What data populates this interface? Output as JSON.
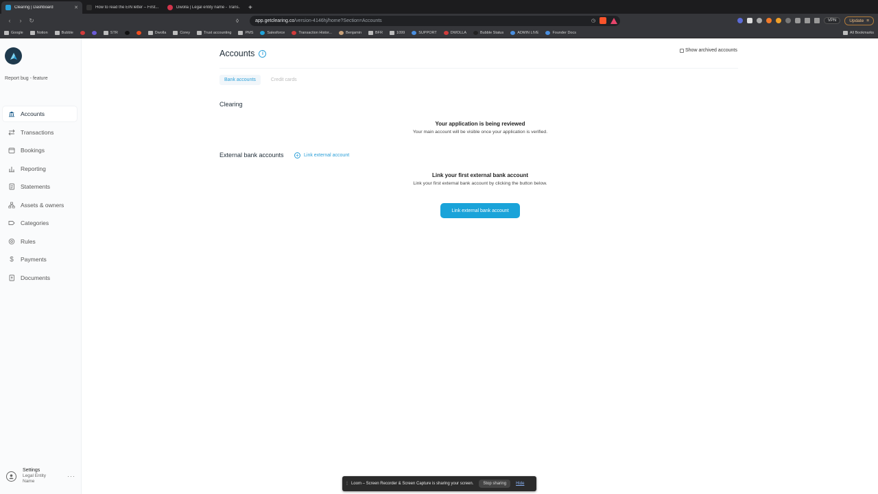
{
  "browser": {
    "tabs": [
      {
        "title": "Clearing | Dashboard",
        "favicon_color": "#2a9fd8"
      },
      {
        "title": "How to read the EIN letter – First...",
        "favicon_color": "#333333"
      },
      {
        "title": "Dwolla | Legal entity name - Trans...",
        "favicon_color": "#d1344b"
      }
    ],
    "new_tab_label": "+",
    "url_host": "app.getclearing.co",
    "url_path": "/version-4146hj/home?Section=Accounts",
    "vpn_label": "VPN",
    "update_label": "Update",
    "bookmarks": [
      {
        "label": "Google",
        "kind": "folder"
      },
      {
        "label": "Notion",
        "kind": "folder"
      },
      {
        "label": "Bubble",
        "kind": "folder"
      },
      {
        "label": "",
        "kind": "icon-red"
      },
      {
        "label": "",
        "kind": "icon-purple"
      },
      {
        "label": "STR",
        "kind": "folder"
      },
      {
        "label": "",
        "kind": "icon-c"
      },
      {
        "label": "",
        "kind": "icon-figma"
      },
      {
        "label": "Dwolla",
        "kind": "folder"
      },
      {
        "label": "Corey",
        "kind": "folder"
      },
      {
        "label": "Trust accounting",
        "kind": "folder"
      },
      {
        "label": "PMS",
        "kind": "folder"
      },
      {
        "label": "Salesforce",
        "kind": "icon-cloud"
      },
      {
        "label": "Transaction Histor...",
        "kind": "icon-red"
      },
      {
        "label": "Benjamin",
        "kind": "icon-avatar"
      },
      {
        "label": "BFR",
        "kind": "folder"
      },
      {
        "label": "1099",
        "kind": "folder"
      },
      {
        "label": "SUPPORT",
        "kind": "icon-blue"
      },
      {
        "label": "DWOLLA",
        "kind": "icon-red"
      },
      {
        "label": "Bubble Status",
        "kind": "icon-dark"
      },
      {
        "label": "ADMIN LIVE",
        "kind": "icon-blue"
      },
      {
        "label": "Founder Docs",
        "kind": "icon-blue"
      }
    ],
    "all_bookmarks_label": "All Bookmarks"
  },
  "sidebar": {
    "report_label": "Report bug - feature",
    "items": [
      {
        "label": "Accounts",
        "icon": "bank-icon",
        "active": true
      },
      {
        "label": "Transactions",
        "icon": "arrows-icon",
        "active": false
      },
      {
        "label": "Bookings",
        "icon": "calendar-icon",
        "active": false
      },
      {
        "label": "Reporting",
        "icon": "bar-chart-icon",
        "active": false
      },
      {
        "label": "Statements",
        "icon": "document-icon",
        "active": false
      },
      {
        "label": "Assets & owners",
        "icon": "org-icon",
        "active": false
      },
      {
        "label": "Categories",
        "icon": "tag-icon",
        "active": false
      },
      {
        "label": "Rules",
        "icon": "rules-icon",
        "active": false
      },
      {
        "label": "Payments",
        "icon": "dollar-icon",
        "active": false
      },
      {
        "label": "Documents",
        "icon": "upload-doc-icon",
        "active": false
      }
    ],
    "settings": {
      "title": "Settings",
      "subtitle": "Legal Entity Name",
      "more": "···"
    }
  },
  "main": {
    "title": "Accounts",
    "show_archived_label": "Show archived accounts",
    "tabs": [
      {
        "label": "Bank accounts",
        "active": true
      },
      {
        "label": "Credit cards",
        "active": false
      }
    ],
    "clearing_heading": "Clearing",
    "clearing_empty_title": "Your application is being reviewed",
    "clearing_empty_body": "Your main account will be visible once your application is verified.",
    "external_heading": "External bank accounts",
    "link_external_label": "Link external account",
    "external_empty_title": "Link your first external bank account",
    "external_empty_body": "Link your first external bank account by clicking the button below.",
    "cta_label": "Link external bank account"
  },
  "loom": {
    "message": "Loom – Screen Recorder & Screen Capture is sharing your screen.",
    "stop_label": "Stop sharing",
    "hide_label": "Hide"
  },
  "colors": {
    "accent": "#1aa3d9",
    "sidebar_bg": "#fafbfc",
    "chrome_bg": "#35363a"
  }
}
